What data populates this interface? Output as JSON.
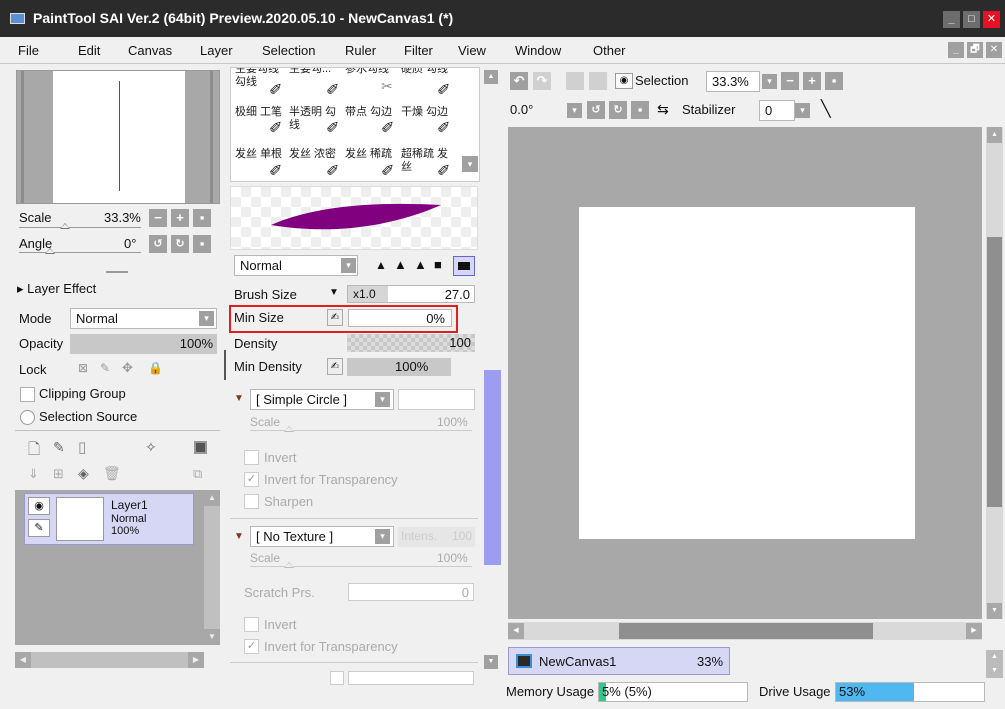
{
  "window": {
    "title": "PaintTool SAI Ver.2 (64bit) Preview.2020.05.10 - NewCanvas1 (*)",
    "minimize": "_",
    "maximize": "□",
    "close": "✕"
  },
  "menu": {
    "items": [
      "File",
      "Edit",
      "Canvas",
      "Layer",
      "Selection",
      "Ruler",
      "Filter",
      "View",
      "Window",
      "Other"
    ],
    "mdi_min": "_",
    "mdi_restore": "🗗",
    "mdi_close": "✕"
  },
  "navigator": {
    "scale_label": "Scale",
    "scale_value": "33.3%",
    "angle_label": "Angle",
    "angle_value": "0°"
  },
  "layer_panel": {
    "layer_effect": "Layer Effect",
    "mode_label": "Mode",
    "mode_value": "Normal",
    "opacity_label": "Opacity",
    "opacity_value": "100%",
    "lock_label": "Lock",
    "clipping_group": "Clipping Group",
    "selection_source": "Selection Source",
    "layers": [
      {
        "name": "Layer1",
        "mode": "Normal",
        "opacity": "100%"
      }
    ]
  },
  "brushes": {
    "rows": [
      [
        "主要勾线 勾线",
        "主要勾...",
        "参水勾线",
        "硬质 勾线"
      ],
      [
        "极细 工笔",
        "半透明 勾线",
        "带点 勾边",
        "干燥 勾边"
      ],
      [
        "发丝 单根",
        "发丝 浓密",
        "发丝 稀疏",
        "超稀疏 发丝"
      ]
    ]
  },
  "brush_settings": {
    "blend_mode": "Normal",
    "brush_size_label": "Brush Size",
    "brush_size_mult": "x1.0",
    "brush_size_value": "27.0",
    "min_size_label": "Min Size",
    "min_size_value": "0%",
    "density_label": "Density",
    "density_value": "100",
    "min_density_label": "Min Density",
    "min_density_value": "100%",
    "shape_value": "[ Simple Circle ]",
    "shape_scale_label": "Scale",
    "shape_scale_value": "100%",
    "invert": "Invert",
    "invert_transparency": "Invert for Transparency",
    "sharpen": "Sharpen",
    "texture_value": "[ No Texture ]",
    "intens_label": "Intens.",
    "intens_value": "100",
    "texture_scale_label": "Scale",
    "texture_scale_value": "100%",
    "scratch_label": "Scratch Prs.",
    "scratch_value": "0",
    "invert2": "Invert",
    "invert_transparency2": "Invert for Transparency"
  },
  "canvas_toolbar": {
    "selection_label": "Selection",
    "zoom_value": "33.3%",
    "angle_value": "0.0°",
    "stabilizer_label": "Stabilizer",
    "stabilizer_value": "0"
  },
  "canvas_tabs": [
    {
      "name": "NewCanvas1",
      "zoom": "33%"
    }
  ],
  "status": {
    "memory_label": "Memory Usage",
    "memory_value": "5% (5%)",
    "memory_fraction": 0.05,
    "drive_label": "Drive Usage",
    "drive_value": "53%",
    "drive_fraction": 0.53
  },
  "colors": {
    "titlebar": "#2b2b2b",
    "close_red": "#e81123",
    "selected_layer": "#d6d6f5",
    "highlight_red": "#e02020",
    "brush_stroke": "#800080",
    "memory_bar": "#2fc98f",
    "drive_bar": "#4fb8f0",
    "scrollbar_blue": "#9c9cf0"
  }
}
